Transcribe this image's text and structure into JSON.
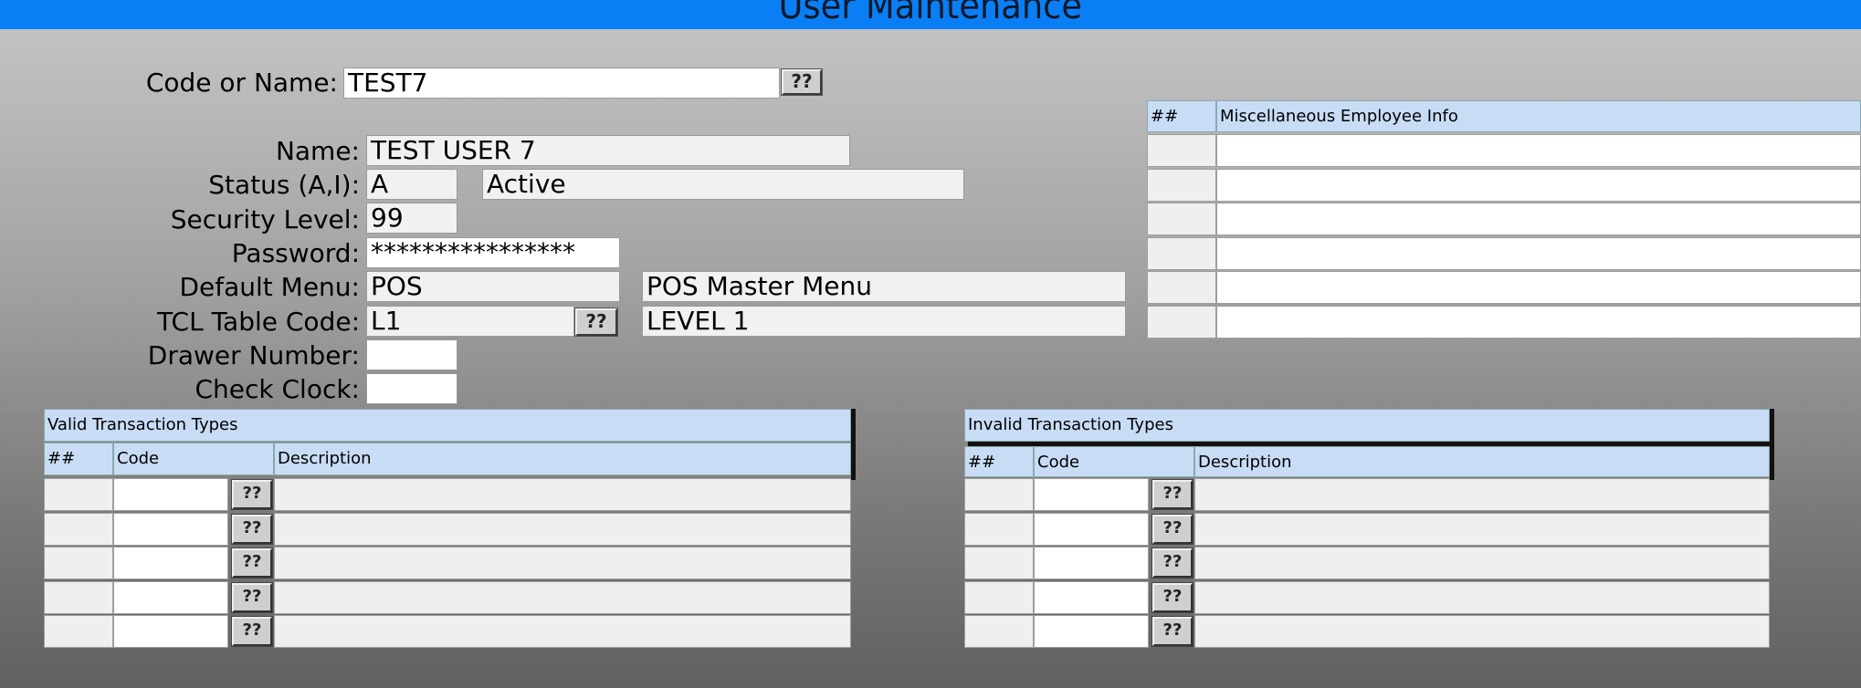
{
  "window": {
    "title": "User Maintenance"
  },
  "lookup": {
    "label": "Code or Name:",
    "value": "TEST7",
    "button": "??"
  },
  "form": {
    "name_label": "Name:",
    "name_value": "TEST USER 7",
    "status_label": "Status (A,I):",
    "status_code": "A",
    "status_desc": "Active",
    "security_label": "Security Level:",
    "security_value": "99",
    "password_label": "Password:",
    "password_value": "****************",
    "menu_label": "Default Menu:",
    "menu_code": "POS",
    "menu_desc": "POS Master Menu",
    "tcl_label": "TCL Table Code:",
    "tcl_code": "L1",
    "tcl_button": "??",
    "tcl_desc": "LEVEL 1",
    "drawer_label": "Drawer Number:",
    "drawer_value": "",
    "clock_label": "Check Clock:",
    "clock_value": ""
  },
  "misc_grid": {
    "col_num": "##",
    "col_info": "Miscellaneous Employee Info",
    "rows": [
      "",
      "",
      "",
      "",
      "",
      ""
    ]
  },
  "valid_grid": {
    "title": "Valid Transaction Types",
    "col_num": "##",
    "col_code": "Code",
    "col_desc": "Description",
    "button": "??",
    "rows": [
      {
        "num": "",
        "code": "",
        "desc": ""
      },
      {
        "num": "",
        "code": "",
        "desc": ""
      },
      {
        "num": "",
        "code": "",
        "desc": ""
      },
      {
        "num": "",
        "code": "",
        "desc": ""
      },
      {
        "num": "",
        "code": "",
        "desc": ""
      }
    ]
  },
  "invalid_grid": {
    "title": "Invalid Transaction Types",
    "col_num": "##",
    "col_code": "Code",
    "col_desc": "Description",
    "button": "??",
    "rows": [
      {
        "num": "",
        "code": "",
        "desc": ""
      },
      {
        "num": "",
        "code": "",
        "desc": ""
      },
      {
        "num": "",
        "code": "",
        "desc": ""
      },
      {
        "num": "",
        "code": "",
        "desc": ""
      },
      {
        "num": "",
        "code": "",
        "desc": ""
      }
    ]
  },
  "colors": {
    "titlebar": "#0a7ff5",
    "grid_header": "#c9dcf6"
  }
}
